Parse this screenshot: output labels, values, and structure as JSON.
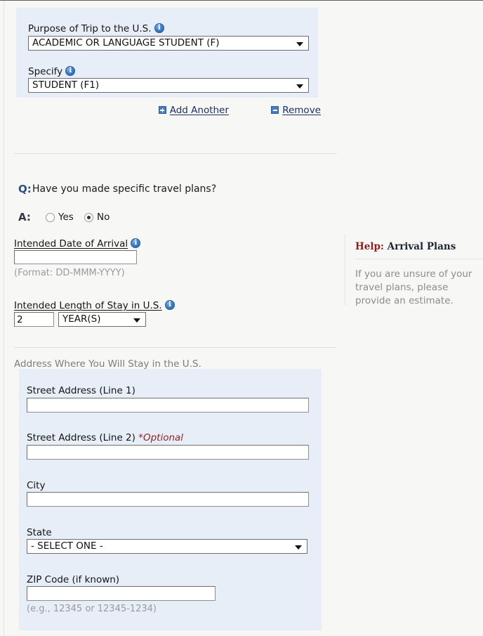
{
  "purpose_section": {
    "purpose_label": "Purpose of Trip to the U.S.",
    "purpose_info_icon": "info-icon",
    "purpose_value": "ACADEMIC OR LANGUAGE STUDENT (F)",
    "specify_label": "Specify",
    "specify_info_icon": "info-icon",
    "specify_value": "STUDENT (F1)",
    "add_another_label": "Add Another",
    "add_another_icon": "plus-icon",
    "remove_label": "Remove",
    "remove_icon": "minus-icon"
  },
  "travel_plans": {
    "q_marker": "Q:",
    "question": "Have you made specific travel plans?",
    "a_marker": "A:",
    "options": [
      {
        "label": "Yes",
        "checked": false
      },
      {
        "label": "No",
        "checked": true
      }
    ]
  },
  "arrival": {
    "date_label": "Intended Date of Arrival",
    "date_info_icon": "info-icon",
    "date_value": "",
    "date_format_hint": "(Format: DD-MMM-YYYY)",
    "length_label": "Intended Length of Stay in U.S.",
    "length_info_icon": "info-icon",
    "length_value": "2",
    "length_unit": "YEAR(S)"
  },
  "help": {
    "title_prefix": "Help:",
    "title_subject": "Arrival Plans",
    "body": "If you are unsure of your travel plans, please provide an estimate."
  },
  "address": {
    "section_header": "Address Where You Will Stay in the U.S.",
    "street1_label": "Street Address (Line 1)",
    "street1_value": "",
    "street2_label": "Street Address (Line 2)",
    "street2_optional": "*Optional",
    "street2_value": "",
    "city_label": "City",
    "city_value": "",
    "state_label": "State",
    "state_value": "- SELECT ONE -",
    "zip_label": "ZIP Code (if known)",
    "zip_value": "",
    "zip_hint": "(e.g., 12345 or 12345-1234)"
  },
  "colors": {
    "panel_blue": "#e8eef7",
    "page_bg": "#f7f7f5",
    "link_navy": "#1c2f62",
    "help_red": "#8a2020",
    "optional_red": "#8a2424",
    "info_blue": "#3f7fc6",
    "hint_gray": "#9a9a9a"
  }
}
